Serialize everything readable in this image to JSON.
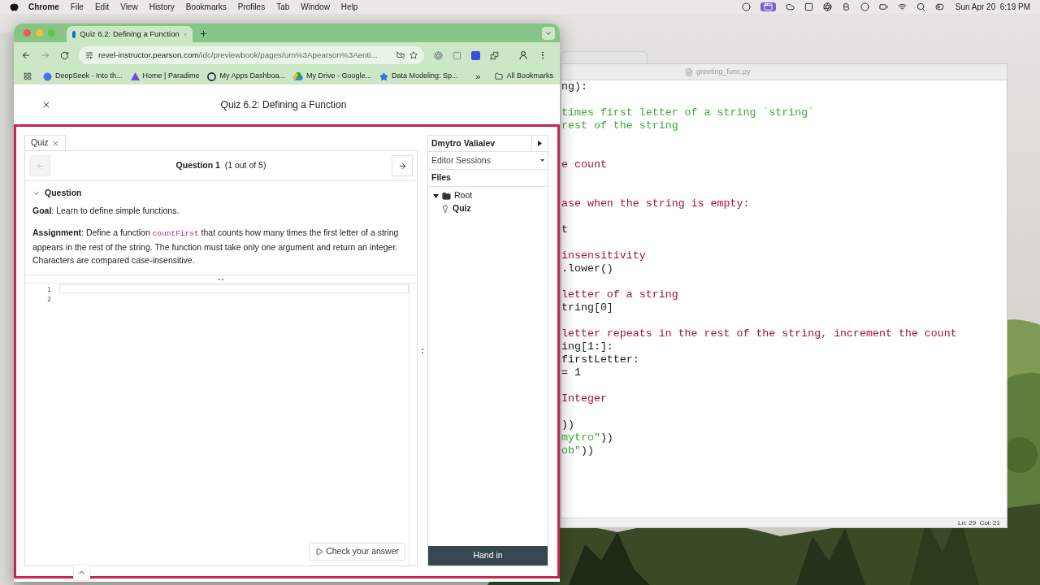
{
  "menu_bar": {
    "app_name": "Chrome",
    "menus": [
      "File",
      "Edit",
      "View",
      "History",
      "Bookmarks",
      "Profiles",
      "Tab",
      "Window",
      "Help"
    ],
    "clock": "Sun Apr 20  6:19 PM"
  },
  "editor_window": {
    "title": "greeting_func.py",
    "status": "Ln: 29  Col: 21",
    "lines": [
      {
        "kind": "text",
        "segments": [
          {
            "text": "ng):",
            "kind": "code"
          }
        ]
      },
      {
        "kind": "blank"
      },
      {
        "kind": "text",
        "segments": [
          {
            "text": "times first letter of a string `string`",
            "kind": "string"
          }
        ]
      },
      {
        "kind": "text",
        "segments": [
          {
            "text": "rest of the string",
            "kind": "string"
          }
        ]
      },
      {
        "kind": "blank"
      },
      {
        "kind": "blank"
      },
      {
        "kind": "text",
        "segments": [
          {
            "text": "e count",
            "kind": "comment"
          }
        ]
      },
      {
        "kind": "blank"
      },
      {
        "kind": "blank"
      },
      {
        "kind": "text",
        "segments": [
          {
            "text": "ase when the string is empty:",
            "kind": "comment"
          }
        ]
      },
      {
        "kind": "blank"
      },
      {
        "kind": "text",
        "segments": [
          {
            "text": "t",
            "kind": "code"
          }
        ]
      },
      {
        "kind": "blank"
      },
      {
        "kind": "text",
        "segments": [
          {
            "text": "insensitivity",
            "kind": "comment"
          }
        ]
      },
      {
        "kind": "text",
        "segments": [
          {
            "text": ".lower()",
            "kind": "code"
          }
        ]
      },
      {
        "kind": "blank"
      },
      {
        "kind": "text",
        "segments": [
          {
            "text": "letter of a string",
            "kind": "comment"
          }
        ]
      },
      {
        "kind": "text",
        "segments": [
          {
            "text": "tring[0]",
            "kind": "code"
          }
        ]
      },
      {
        "kind": "blank"
      },
      {
        "kind": "text",
        "segments": [
          {
            "text": "letter repeats in the rest of the string, increment the count",
            "kind": "comment"
          }
        ]
      },
      {
        "kind": "text",
        "segments": [
          {
            "text": "ing[1:]:",
            "kind": "code"
          }
        ]
      },
      {
        "kind": "text",
        "segments": [
          {
            "text": "firstLetter:",
            "kind": "code"
          }
        ]
      },
      {
        "kind": "text",
        "segments": [
          {
            "text": "= 1",
            "kind": "code"
          }
        ]
      },
      {
        "kind": "blank"
      },
      {
        "kind": "text",
        "segments": [
          {
            "text": "Integer",
            "kind": "comment"
          }
        ]
      },
      {
        "kind": "blank"
      },
      {
        "kind": "text",
        "segments": [
          {
            "text": "))",
            "kind": "code"
          }
        ]
      },
      {
        "kind": "text",
        "segments": [
          {
            "text": "mytro\"",
            "kind": "string"
          },
          {
            "text": "))",
            "kind": "code"
          }
        ]
      },
      {
        "kind": "text",
        "segments": [
          {
            "text": "ob\"",
            "kind": "string"
          },
          {
            "text": "))",
            "kind": "code"
          }
        ]
      }
    ]
  },
  "browser": {
    "tab": {
      "title": "Quiz 6.2: Defining a Function",
      "selected": true
    },
    "nav": {
      "back_disabled": false,
      "forward_disabled": true
    },
    "url": {
      "host": "revel-instructor.pearson.com",
      "path": "/idc/previewbook/pages/urn%3Apearson%3Aenti..."
    },
    "bookmarks": [
      "DeepSeek - Into th...",
      "Home | Paradime",
      "My Apps Dashboa...",
      "My Drive - Google...",
      "Data Modeling: Sp..."
    ],
    "more_bookmarks": "»",
    "all_bookmarks": "All Bookmarks"
  },
  "page": {
    "title": "Quiz 6.2: Defining a Function",
    "quiz_tab": "Quiz",
    "question_nav": {
      "label": "Question 1",
      "count": "(1 out of 5)",
      "prev_disabled": true,
      "next_disabled": false
    },
    "section": {
      "title": "Question",
      "expanded": true
    },
    "goal": "**Goal**: Learn to define simple functions.",
    "assignment": {
      "label": "Assignment",
      "before": ": Define a function ",
      "code": "countFirst",
      "after": " that counts how many times the first letter of a string appears in the rest of the string. The function must take only one argument and return an integer. Characters are compared case-insensitive."
    },
    "line_numbers": [
      "1",
      "2"
    ],
    "check_button": "Check your answer",
    "sidebar": {
      "user": "Dmytro Valiaiev",
      "sessions": "Editor Sessions",
      "files_title": "Files",
      "tree": [
        {
          "name": "Root",
          "kind": "folder",
          "expanded": true,
          "selected": false,
          "children": [
            {
              "name": "Quiz",
              "kind": "quiz",
              "selected": true
            }
          ]
        }
      ],
      "hand_in": "Hand in"
    }
  }
}
